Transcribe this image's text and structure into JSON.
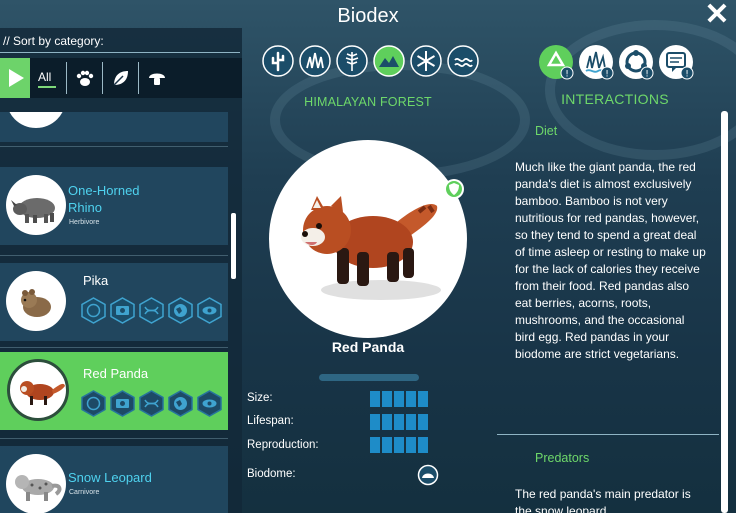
{
  "title": "Biodex",
  "close_glyph": "✕",
  "sidebar": {
    "sort_label": "// Sort by category:",
    "filters": {
      "all_label": "All",
      "icons": [
        "play-icon",
        "paw-icon",
        "leaf-icon",
        "mushroom-icon"
      ]
    },
    "cards": [
      {
        "name": "One-Horned",
        "name2": "Rhino",
        "sub": "Herbivore",
        "style": "cyan"
      },
      {
        "name": "Pika",
        "style": "white",
        "icons": true
      },
      {
        "name": "Red Panda",
        "style": "white",
        "icons": true,
        "selected": true
      },
      {
        "name": "Snow Leopard",
        "sub": "Carnivore",
        "style": "cyan"
      }
    ]
  },
  "center": {
    "biome_title": "HIMALAYAN FOREST",
    "biome_icons": [
      "cactus-icon",
      "grass-icon",
      "fern-icon",
      "mountain-icon",
      "snowflake-icon",
      "water-icon"
    ],
    "selected_biome": "mountain-icon",
    "species_name": "Red Panda",
    "stats": [
      {
        "label": "Size:",
        "level": 5
      },
      {
        "label": "Lifespan:",
        "level": 5
      },
      {
        "label": "Reproduction:",
        "level": 5
      },
      {
        "label": "Biodome:"
      }
    ]
  },
  "interactions": {
    "title": "INTERACTIONS",
    "icons": [
      "recycle-icon",
      "grass-water-icon",
      "cycle-icon",
      "chat-icon"
    ],
    "sections": [
      {
        "heading": "Diet",
        "text": "Much like the giant panda, the red panda's diet is almost exclusively bamboo. Bamboo is not very nutritious for red pandas, however, so they tend to spend a great deal of time asleep or resting to make up for the lack of calories they receive from their food. Red pandas also eat berries, acorns, roots, mushrooms, and the occasional bird egg. Red pandas in your biodome are strict vegetarians."
      },
      {
        "heading": "Predators",
        "text": "The red panda's main predator is the snow leopard."
      }
    ]
  },
  "colors": {
    "accent_green": "#6ed86a",
    "selected_green": "#5fcf5c",
    "cyan_text": "#4fd2ef",
    "stat_blue": "#1e8cc8"
  }
}
